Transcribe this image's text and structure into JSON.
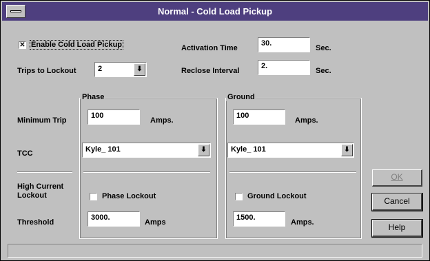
{
  "window": {
    "title": "Normal - Cold Load Pickup"
  },
  "general": {
    "enable_label": "Enable Cold Load Pickup",
    "enable_checked_glyph": "✕",
    "activation_label": "Activation Time",
    "activation_value": "30.",
    "activation_unit": "Sec.",
    "trips_label": "Trips  to Lockout",
    "trips_value": "2",
    "reclose_label": "Reclose Interval",
    "reclose_value": "2.",
    "reclose_unit": "Sec."
  },
  "row_labels": {
    "minimum_trip": "Minimum Trip",
    "tcc": "TCC",
    "high_current_lockout_1": "High Current",
    "high_current_lockout_2": "Lockout",
    "threshold": "Threshold"
  },
  "phase": {
    "legend": "Phase",
    "min_trip_value": "100",
    "min_trip_unit": "Amps.",
    "tcc_value": "Kyle_ 101",
    "lockout_label": "Phase Lockout",
    "threshold_value": "3000.",
    "threshold_unit": "Amps"
  },
  "ground": {
    "legend": "Ground",
    "min_trip_value": "100",
    "min_trip_unit": "Amps.",
    "tcc_value": "Kyle_ 101",
    "lockout_label": "Ground Lockout",
    "threshold_value": "1500.",
    "threshold_unit": "Amps."
  },
  "buttons": {
    "ok_label": "OK",
    "cancel_label": "Cancel",
    "help_label": "Help"
  },
  "icons": {
    "dropdown": "down-arrow-icon",
    "system_menu": "system-menu-icon"
  }
}
